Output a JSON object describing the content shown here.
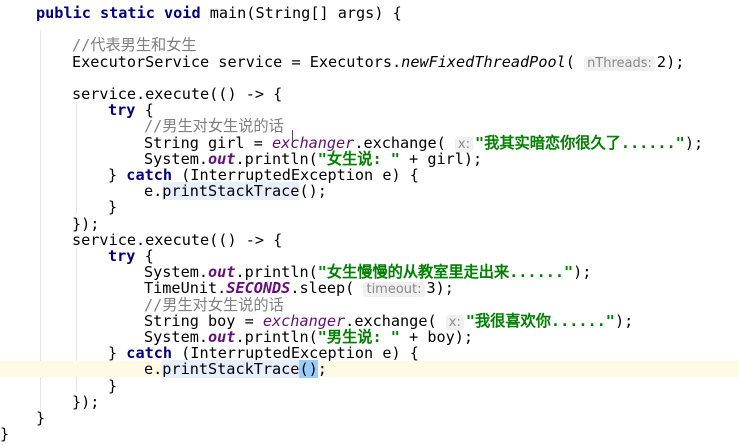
{
  "editor": {
    "lines": [
      {
        "indent": 36,
        "tokens": [
          {
            "t": "public static void",
            "c": "kw"
          },
          {
            "t": " main(String[] args) {"
          }
        ]
      },
      {
        "indent": 0,
        "tokens": []
      },
      {
        "indent": 72,
        "tokens": [
          {
            "t": "//代表男生和女生",
            "c": "cmt"
          }
        ]
      },
      {
        "indent": 72,
        "tokens": [
          {
            "t": "ExecutorService service = Executors."
          },
          {
            "t": "newFixedThreadPool",
            "c": "sm"
          },
          {
            "t": "( "
          },
          {
            "t": "nThreads:",
            "c": "hint"
          },
          {
            "t": "2);"
          }
        ]
      },
      {
        "indent": 0,
        "tokens": []
      },
      {
        "indent": 72,
        "tokens": [
          {
            "t": "service.execute(() -> {"
          }
        ]
      },
      {
        "indent": 108,
        "tokens": [
          {
            "t": "try",
            "c": "kw"
          },
          {
            "t": " {"
          }
        ]
      },
      {
        "indent": 144,
        "tokens": [
          {
            "t": "//男生对女生说的话",
            "c": "cmt"
          }
        ]
      },
      {
        "indent": 144,
        "tokens": [
          {
            "t": "String girl = "
          },
          {
            "t": "exchanger",
            "c": "fld"
          },
          {
            "t": ".exchange( "
          },
          {
            "t": "x:",
            "c": "hint"
          },
          {
            "t": "\"我其实暗恋你很久了......\"",
            "c": "str"
          },
          {
            "t": ");"
          }
        ]
      },
      {
        "indent": 144,
        "tokens": [
          {
            "t": "System."
          },
          {
            "t": "out",
            "c": "sfld"
          },
          {
            "t": ".println("
          },
          {
            "t": "\"女生说: \"",
            "c": "str"
          },
          {
            "t": " + girl);"
          }
        ]
      },
      {
        "indent": 108,
        "tokens": [
          {
            "t": "} "
          },
          {
            "t": "catch",
            "c": "kw"
          },
          {
            "t": " (InterruptedException e) {"
          }
        ]
      },
      {
        "indent": 144,
        "tokens": [
          {
            "t": "e."
          },
          {
            "t": "printStackTrace",
            "c": "usage"
          },
          {
            "t": "();"
          }
        ]
      },
      {
        "indent": 108,
        "tokens": [
          {
            "t": "}"
          }
        ]
      },
      {
        "indent": 72,
        "tokens": [
          {
            "t": "});"
          }
        ]
      },
      {
        "indent": 72,
        "tokens": [
          {
            "t": "service.execute(() -> {"
          }
        ]
      },
      {
        "indent": 108,
        "tokens": [
          {
            "t": "try",
            "c": "kw"
          },
          {
            "t": " {"
          }
        ]
      },
      {
        "indent": 144,
        "tokens": [
          {
            "t": "System."
          },
          {
            "t": "out",
            "c": "sfld"
          },
          {
            "t": ".println("
          },
          {
            "t": "\"女生慢慢的从教室里走出来......\"",
            "c": "str"
          },
          {
            "t": ");"
          }
        ]
      },
      {
        "indent": 144,
        "tokens": [
          {
            "t": "TimeUnit."
          },
          {
            "t": "SECONDS",
            "c": "sfld"
          },
          {
            "t": ".sleep( "
          },
          {
            "t": "timeout:",
            "c": "hint"
          },
          {
            "t": "3);"
          }
        ]
      },
      {
        "indent": 144,
        "tokens": [
          {
            "t": "//男生对女生说的话",
            "c": "cmt"
          }
        ]
      },
      {
        "indent": 144,
        "tokens": [
          {
            "t": "String boy = "
          },
          {
            "t": "exchanger",
            "c": "fld"
          },
          {
            "t": ".exchange( "
          },
          {
            "t": "x:",
            "c": "hint"
          },
          {
            "t": "\"我很喜欢你......\"",
            "c": "str"
          },
          {
            "t": ");"
          }
        ]
      },
      {
        "indent": 144,
        "tokens": [
          {
            "t": "System."
          },
          {
            "t": "out",
            "c": "sfld"
          },
          {
            "t": ".println("
          },
          {
            "t": "\"男生说: \"",
            "c": "str"
          },
          {
            "t": " + boy);"
          }
        ]
      },
      {
        "indent": 108,
        "tokens": [
          {
            "t": "} "
          },
          {
            "t": "catch",
            "c": "kw"
          },
          {
            "t": " (InterruptedException e) {"
          }
        ]
      },
      {
        "indent": 144,
        "current": true,
        "tokens": [
          {
            "t": "e."
          },
          {
            "t": "printStackTrace",
            "c": "usage"
          },
          {
            "t": "(",
            "c": "paren"
          },
          {
            "t": ")",
            "c": "paren"
          },
          {
            "t": ";"
          }
        ]
      },
      {
        "indent": 108,
        "tokens": [
          {
            "t": "}"
          }
        ]
      },
      {
        "indent": 72,
        "tokens": [
          {
            "t": "});"
          }
        ]
      },
      {
        "indent": 36,
        "tokens": [
          {
            "t": "}"
          }
        ]
      },
      {
        "indent": 0,
        "tokens": [
          {
            "t": "}"
          }
        ]
      }
    ]
  }
}
